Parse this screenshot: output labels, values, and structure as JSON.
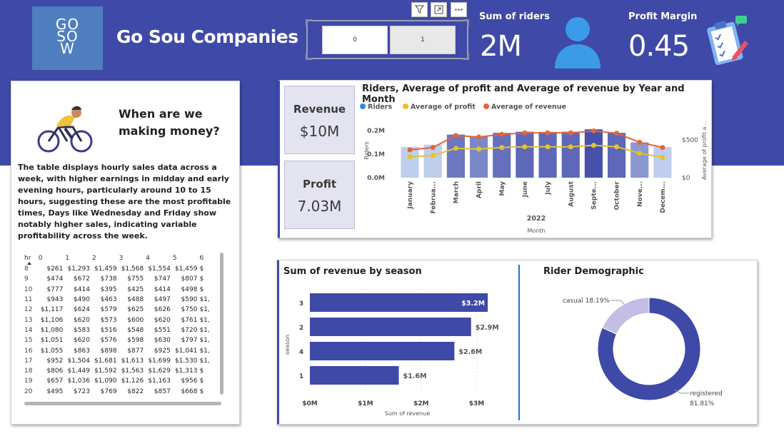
{
  "header": {
    "logo_lines": [
      "GO",
      "SO",
      "W"
    ],
    "company": "Go Sou Companies",
    "slicer": {
      "options": [
        "0",
        "1"
      ]
    },
    "toolbar_icons": [
      "filter-icon",
      "focus-mode-icon",
      "more-options-icon"
    ],
    "kpis": [
      {
        "label": "Sum of riders",
        "value": "2M",
        "icon": "person-icon"
      },
      {
        "label": "Profit Margin",
        "value": "0.45",
        "icon": "clipboard-icon"
      }
    ]
  },
  "left_panel": {
    "heading": "When are we making money?",
    "description": "The table displays hourly sales data across a week, with higher earnings in midday and early evening hours, particularly around 10 to 15 hours, suggesting these are the most profitable times, Days like Wednesday and Friday show notably higher sales, indicating variable profitability across the week.",
    "table": {
      "columns": [
        "hr",
        "0",
        "1",
        "2",
        "3",
        "4",
        "5",
        "6"
      ],
      "rows": [
        [
          "8",
          "$261",
          "$1,293",
          "$1,459",
          "$1,568",
          "$1,554",
          "$1,459",
          "$"
        ],
        [
          "9",
          "$474",
          "$672",
          "$738",
          "$755",
          "$747",
          "$807",
          "$"
        ],
        [
          "10",
          "$777",
          "$414",
          "$395",
          "$425",
          "$414",
          "$498",
          "$"
        ],
        [
          "11",
          "$943",
          "$490",
          "$463",
          "$488",
          "$497",
          "$590",
          "$1,"
        ],
        [
          "12",
          "$1,117",
          "$624",
          "$579",
          "$625",
          "$626",
          "$750",
          "$1,"
        ],
        [
          "13",
          "$1,106",
          "$620",
          "$573",
          "$600",
          "$620",
          "$761",
          "$1,"
        ],
        [
          "14",
          "$1,080",
          "$583",
          "$516",
          "$548",
          "$551",
          "$720",
          "$1,"
        ],
        [
          "15",
          "$1,051",
          "$620",
          "$576",
          "$598",
          "$630",
          "$797",
          "$1,"
        ],
        [
          "16",
          "$1,055",
          "$863",
          "$898",
          "$877",
          "$925",
          "$1,041",
          "$1,"
        ],
        [
          "17",
          "$952",
          "$1,504",
          "$1,681",
          "$1,613",
          "$1,699",
          "$1,530",
          "$1,"
        ],
        [
          "18",
          "$806",
          "$1,449",
          "$1,592",
          "$1,563",
          "$1,629",
          "$1,313",
          "$"
        ],
        [
          "19",
          "$657",
          "$1,036",
          "$1,090",
          "$1,126",
          "$1,163",
          "$956",
          "$"
        ],
        [
          "20",
          "$495",
          "$723",
          "$769",
          "$822",
          "$857",
          "$668",
          "$"
        ]
      ]
    }
  },
  "kpi_cards": [
    {
      "label": "Revenue",
      "value": "$10M"
    },
    {
      "label": "Profit",
      "value": "7.03M"
    }
  ],
  "colors": {
    "header_bg": "#3f49a8",
    "bar_dark": "#3f49a8",
    "bar_light": "#d6e6f8",
    "profit_line": "#e5c12c",
    "revenue_line": "#e0663c",
    "donut_registered": "#3f49a8",
    "donut_casual": "#c4bde6"
  },
  "chart_data": [
    {
      "type": "combo",
      "title": "Riders, Average of profit and Average of revenue by Year and Month",
      "legend": [
        "Riders",
        "Average of profit",
        "Average of revenue"
      ],
      "legend_colors": [
        "#2f86e0",
        "#e5c12c",
        "#e0663c"
      ],
      "year_label": "2022",
      "xlabel": "Month",
      "ylabel": "Riders",
      "y2label": "Average of profit a...",
      "categories": [
        "January",
        "Februa...",
        "March",
        "April",
        "May",
        "June",
        "July",
        "August",
        "Septe...",
        "October",
        "Nove...",
        "Decem..."
      ],
      "y_ticks": [
        "0.0M",
        "0.1M",
        "0.2M"
      ],
      "y_ticks_values": [
        0,
        100000,
        200000
      ],
      "y2_ticks": [
        "$0",
        "$500"
      ],
      "y2_ticks_values": [
        0,
        500
      ],
      "riders": [
        130000,
        140000,
        183000,
        175000,
        190000,
        195000,
        194000,
        195000,
        205000,
        190000,
        150000,
        130000
      ],
      "bar_shade": [
        0.15,
        0.15,
        0.7,
        0.6,
        0.75,
        0.8,
        0.8,
        0.8,
        0.95,
        0.8,
        0.5,
        0.15
      ],
      "average_of_profit": [
        278,
        295,
        390,
        380,
        400,
        410,
        410,
        410,
        430,
        410,
        325,
        270
      ],
      "average_of_revenue": [
        370,
        400,
        560,
        540,
        575,
        595,
        595,
        595,
        620,
        590,
        470,
        400
      ],
      "y_range": [
        0,
        230000
      ],
      "y2_range": [
        0,
        720
      ]
    },
    {
      "type": "bar",
      "orientation": "horizontal",
      "title": "Sum of revenue by season",
      "categories": [
        "3",
        "2",
        "4",
        "1"
      ],
      "values": [
        3.2,
        2.9,
        2.6,
        1.6
      ],
      "data_labels": [
        "$3.2M",
        "$2.9M",
        "$2.6M",
        "$1.6M"
      ],
      "x_ticks": [
        "$0M",
        "$1M",
        "$2M",
        "$3M"
      ],
      "x_ticks_values": [
        0,
        1,
        2,
        3
      ],
      "xlabel": "Sum of revenue",
      "ylabel": "season",
      "x_range": [
        0,
        3.25
      ]
    },
    {
      "type": "pie",
      "style": "donut",
      "title": "Rider Demographic",
      "labels": [
        "registered",
        "casual"
      ],
      "values": [
        81.81,
        18.19
      ],
      "data_labels": [
        "registered\n81.81%",
        "casual 18.19%"
      ]
    }
  ]
}
